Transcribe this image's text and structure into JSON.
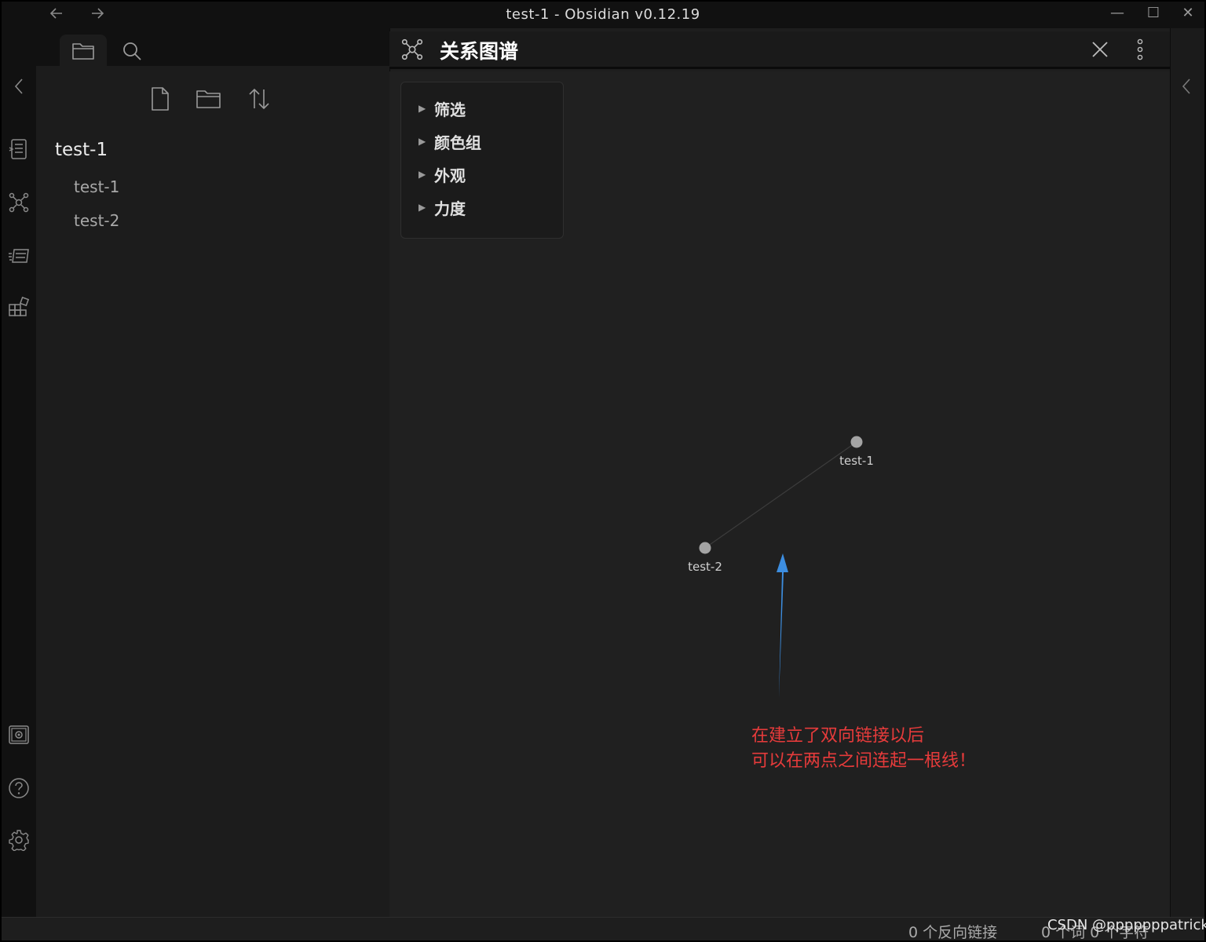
{
  "window": {
    "title": "test-1 - Obsidian v0.12.19"
  },
  "titlebar": {
    "back_icon": "arrow-left-icon",
    "forward_icon": "arrow-right-icon",
    "minimize_glyph": "—",
    "maximize_glyph": "☐",
    "close_glyph": "✕"
  },
  "ribbon": {
    "collapse_glyph": "‹",
    "icons": [
      "open-quick-switcher-icon",
      "graph-view-icon",
      "slides-icon",
      "command-palette-icon",
      "vault-icon",
      "help-icon",
      "settings-icon"
    ]
  },
  "sidebar": {
    "tabs": [
      "file-explorer-icon",
      "search-icon"
    ],
    "actions": [
      "new-note-icon",
      "new-folder-icon",
      "sort-icon"
    ],
    "folder": "test-1",
    "files": [
      "test-1",
      "test-2"
    ]
  },
  "graph": {
    "title": "关系图谱",
    "settings": [
      {
        "label": "筛选"
      },
      {
        "label": "颜色组"
      },
      {
        "label": "外观"
      },
      {
        "label": "力度"
      }
    ],
    "nodes": [
      {
        "label": "test-1"
      },
      {
        "label": "test-2"
      }
    ],
    "annotation": {
      "line1": "在建立了双向链接以后",
      "line2": "可以在两点之间连起一根线！",
      "color": "#e73b3b"
    },
    "arrow_color": "#3d8ee0"
  },
  "right_strip": {
    "expand_glyph": "‹"
  },
  "statusbar": {
    "backlinks": "0 个反向链接",
    "counts": "0 个词  0 个字符"
  },
  "watermark": "CSDN @pppppppatrick"
}
